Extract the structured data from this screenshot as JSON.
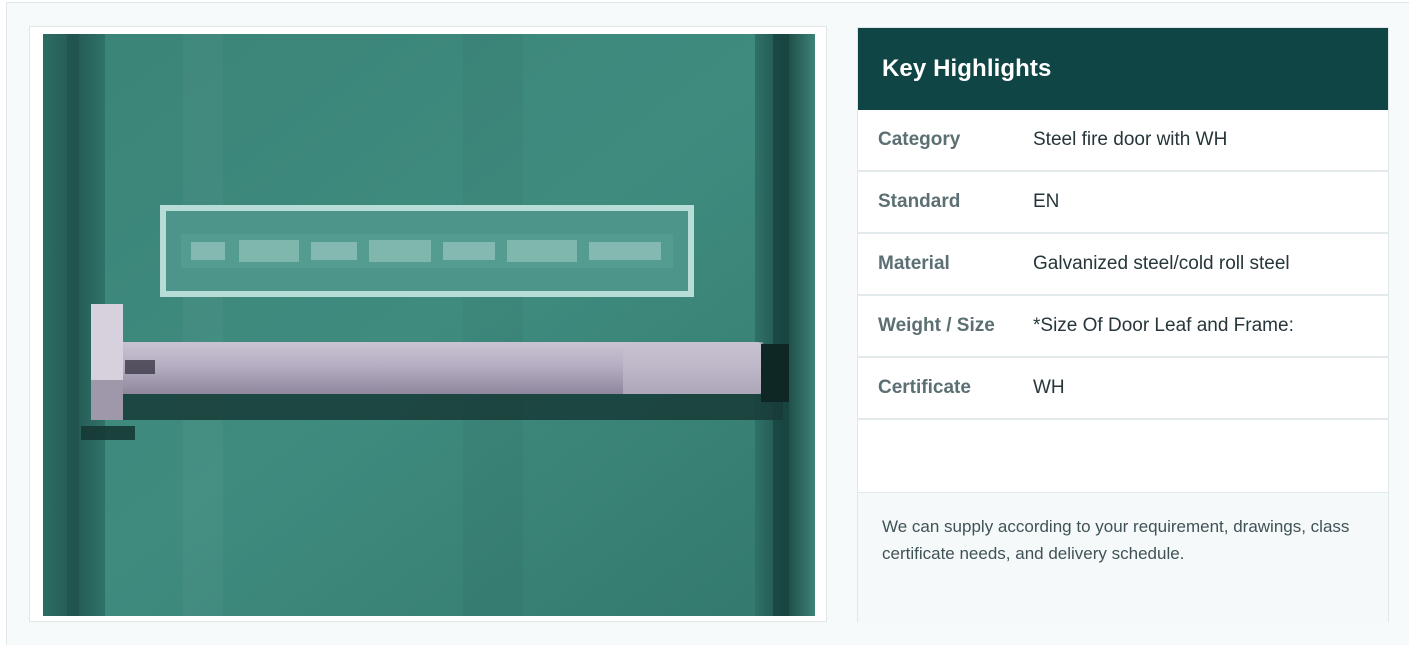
{
  "highlights": {
    "title": "Key Highlights",
    "rows": [
      {
        "label": "Category",
        "value": "Steel fire door with WH"
      },
      {
        "label": "Standard",
        "value": "EN"
      },
      {
        "label": "Material",
        "value": "Galvanized steel/cold roll steel"
      },
      {
        "label": "Weight / Size",
        "value": "*Size Of Door Leaf and Frame:"
      },
      {
        "label": "Certificate",
        "value": "WH"
      }
    ],
    "note": "We can supply according to your requirement, drawings, class certificate needs, and delivery schedule."
  },
  "colors": {
    "header_bg": "#0f4645",
    "door_green": "#3d8a7d",
    "panic_bar": "#b8b0c4"
  },
  "icons": {
    "product_image": "steel-fire-door-with-panic-bar"
  }
}
